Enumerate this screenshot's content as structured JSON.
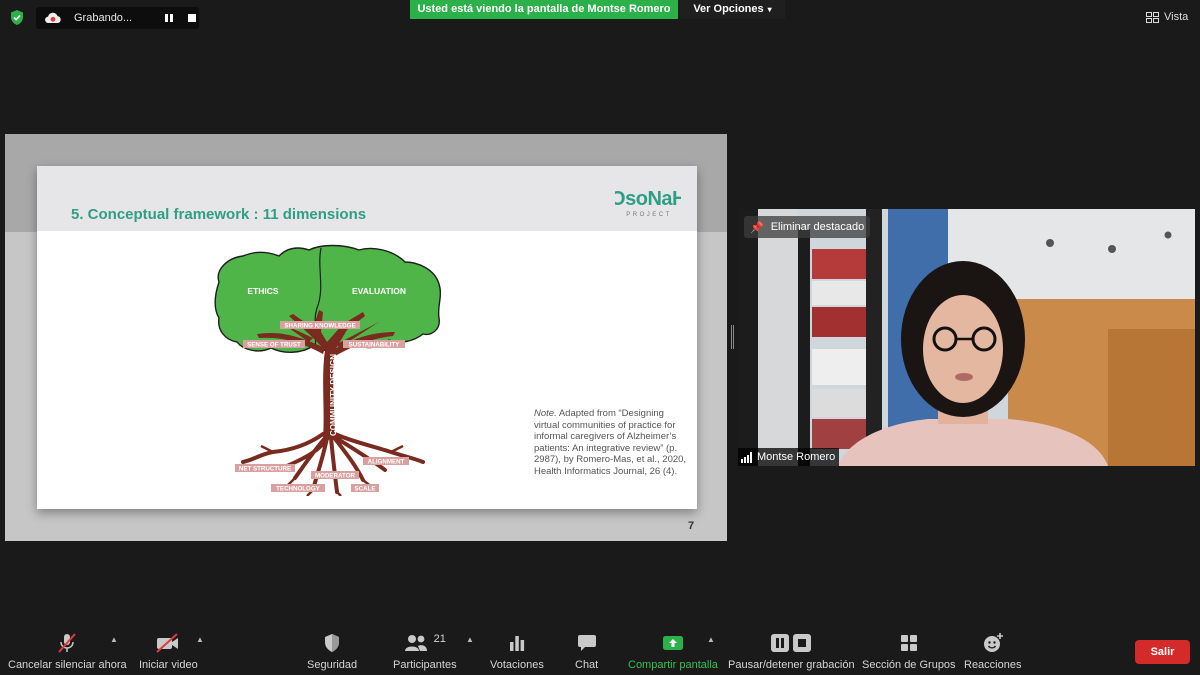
{
  "topbar": {
    "recording_label": "Grabando...",
    "share_banner": "Usted está viendo la pantalla de Montse Romero",
    "view_options": "Ver Opciones",
    "view_label": "Vista"
  },
  "slide": {
    "title": "5. Conceptual framework : 11 dimensions",
    "logo_text": "OsoNaH",
    "logo_sub": "PROJECT",
    "tree_labels": {
      "ethics": "ETHICS",
      "evaluation": "EVALUATION",
      "sharing_knowledge": "SHARING KNOWLEDGE",
      "sense_of_trust": "SENSE OF TRUST",
      "sustainability": "SUSTAINABILITY",
      "community_design": "COMMUNITY DESIGN",
      "net_structure": "NET STRUCTURE",
      "alignment": "ALIGNMENT",
      "moderator": "MODERATOR",
      "technology": "TECHNOLOGY",
      "scale": "SCALE"
    },
    "note_label": "Note.",
    "note_text": "Adapted from “Designing virtual communities of practice for informal caregivers of Alzheimer’s patients: An integrative review” (p. 2987), by Romero-Mas, et al., 2020, Health Informatics Journal, 26 (4).",
    "page_number": "7"
  },
  "video": {
    "unpin_label": "Eliminar destacado",
    "participant_name": "Montse Romero"
  },
  "toolbar": {
    "mute_label": "Cancelar silenciar ahora",
    "video_label": "Iniciar video",
    "security_label": "Seguridad",
    "participants_label": "Participantes",
    "participants_count": "21",
    "polls_label": "Votaciones",
    "chat_label": "Chat",
    "share_label": "Compartir pantalla",
    "record_label": "Pausar/detener grabación",
    "breakout_label": "Sección de Grupos",
    "reactions_label": "Reacciones",
    "leave_label": "Salir"
  },
  "colors": {
    "share_green": "#2bb04a",
    "leave_red": "#d42a2a",
    "slide_title_teal": "#2f9e86",
    "tree_green": "#4fb548",
    "trunk_brown": "#7a2a1e"
  }
}
